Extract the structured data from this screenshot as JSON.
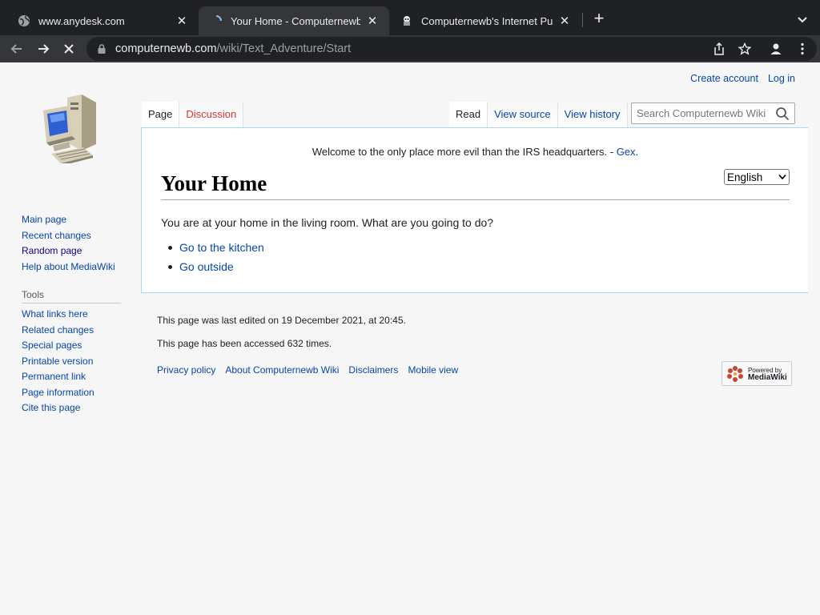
{
  "browser": {
    "tabs": [
      {
        "title": "www.anydesk.com",
        "favicon": "globe-icon",
        "active": false
      },
      {
        "title": "Your Home - Computernewb W",
        "favicon": "loading-icon",
        "active": true
      },
      {
        "title": "Computernewb's Internet Pub",
        "favicon": "pub-icon",
        "active": false
      }
    ],
    "url_host": "computernewb.com",
    "url_path": "/wiki/Text_Adventure/Start"
  },
  "wiki": {
    "personal": {
      "create_account": "Create account",
      "log_in": "Log in"
    },
    "sidebar": {
      "nav": [
        "Main page",
        "Recent changes",
        "Random page",
        "Help about MediaWiki"
      ],
      "tools_heading": "Tools",
      "tools": [
        "What links here",
        "Related changes",
        "Special pages",
        "Printable version",
        "Permanent link",
        "Page information",
        "Cite this page"
      ]
    },
    "tabs": {
      "page": "Page",
      "discussion": "Discussion",
      "read": "Read",
      "view_source": "View source",
      "view_history": "View history"
    },
    "search": {
      "placeholder": "Search Computernewb Wiki"
    },
    "sitenotice": {
      "text": "Welcome to the only place more evil than the IRS headquarters. - ",
      "author": "Gex",
      "end": "."
    },
    "language": {
      "selected": "English"
    },
    "heading": "Your Home",
    "body": "You are at your home in the living room. What are you going to do?",
    "choices": [
      "Go to the kitchen",
      "Go outside"
    ],
    "footer": {
      "last_edited": "This page was last edited on 19 December 2021, at 20:45.",
      "accessed": "This page has been accessed 632 times.",
      "links": [
        "Privacy policy",
        "About Computernewb Wiki",
        "Disclaimers",
        "Mobile view"
      ],
      "powered_small": "Powered by",
      "powered_big": "MediaWiki"
    }
  }
}
